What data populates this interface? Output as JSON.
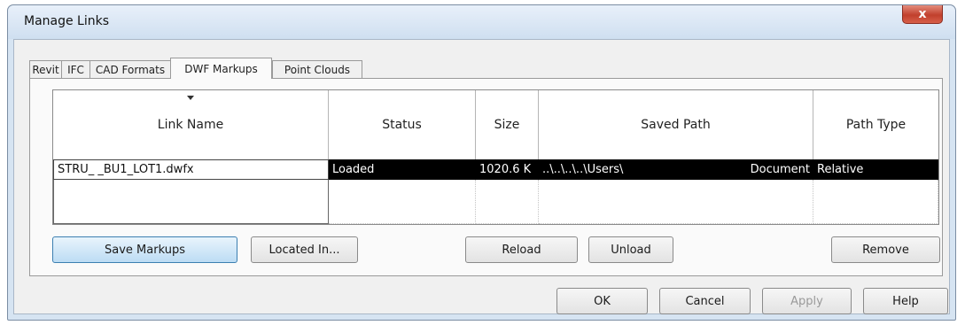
{
  "window": {
    "title": "Manage Links",
    "close_glyph": "x"
  },
  "tabs": [
    {
      "label": "Revit",
      "active": false
    },
    {
      "label": "IFC",
      "active": false
    },
    {
      "label": "CAD Formats",
      "active": false
    },
    {
      "label": "DWF Markups",
      "active": true
    },
    {
      "label": "Point Clouds",
      "active": false
    }
  ],
  "table": {
    "columns": [
      "Link Name",
      "Status",
      "Size",
      "Saved Path",
      "Path Type"
    ],
    "rows": [
      {
        "link_name": "STRU_      _BU1_LOT1.dwfx",
        "status": "Loaded",
        "size": "1020.6 K",
        "saved_path": "..\\..\\..\\..\\Users\\",
        "saved_path_suffix": "Document",
        "path_type": "Relative"
      }
    ]
  },
  "buttons": {
    "save_markups": "Save Markups",
    "located_in": "Located In...",
    "reload": "Reload",
    "unload": "Unload",
    "remove": "Remove",
    "ok": "OK",
    "cancel": "Cancel",
    "apply": "Apply",
    "help": "Help"
  }
}
